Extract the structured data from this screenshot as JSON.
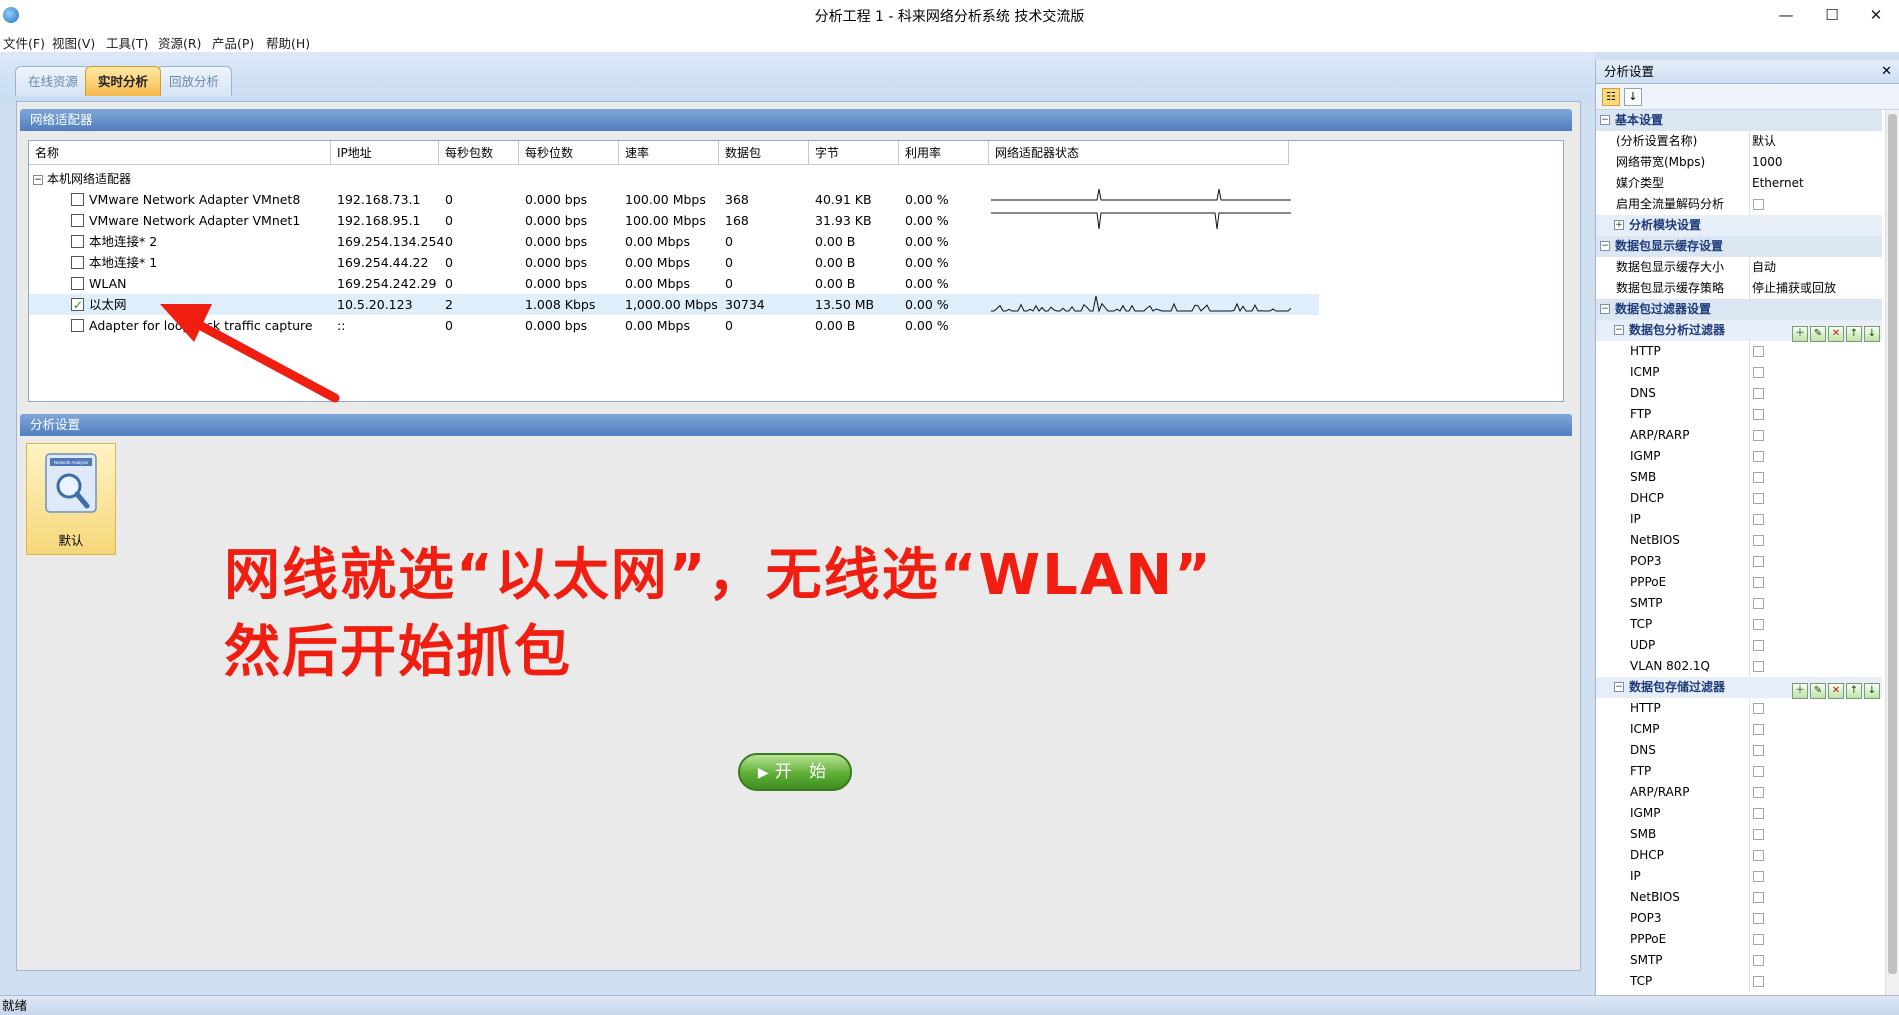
{
  "window": {
    "title": "分析工程 1 - 科来网络分析系统 技术交流版",
    "minimize": "—",
    "maximize": "☐",
    "close": "✕"
  },
  "menu": [
    "文件(F)",
    "视图(V)",
    "工具(T)",
    "资源(R)",
    "产品(P)",
    "帮助(H)"
  ],
  "tabs": [
    {
      "label": "在线资源",
      "active": false
    },
    {
      "label": "实时分析",
      "active": true
    },
    {
      "label": "回放分析",
      "active": false
    }
  ],
  "adapters_panel": {
    "title": "网络适配器",
    "columns": [
      "名称",
      "IP地址",
      "每秒包数",
      "每秒位数",
      "速率",
      "数据包",
      "字节",
      "利用率",
      "网络适配器状态"
    ],
    "group": "本机网络适配器",
    "rows": [
      {
        "name": "VMware Network Adapter VMnet8",
        "ip": "192.168.73.1",
        "pps": "0",
        "bps": "0.000 bps",
        "rate": "100.00 Mbps",
        "packets": "368",
        "bytes": "40.91 KB",
        "util": "0.00 %",
        "checked": false,
        "graph": "spikes-a"
      },
      {
        "name": "VMware Network Adapter VMnet1",
        "ip": "192.168.95.1",
        "pps": "0",
        "bps": "0.000 bps",
        "rate": "100.00 Mbps",
        "packets": "168",
        "bytes": "31.93 KB",
        "util": "0.00 %",
        "checked": false,
        "graph": "spikes-b"
      },
      {
        "name": "本地连接* 2",
        "ip": "169.254.134.254",
        "pps": "0",
        "bps": "0.000 bps",
        "rate": "0.00 Mbps",
        "packets": "0",
        "bytes": "0.00 B",
        "util": "0.00 %",
        "checked": false,
        "graph": "none"
      },
      {
        "name": "本地连接* 1",
        "ip": "169.254.44.22",
        "pps": "0",
        "bps": "0.000 bps",
        "rate": "0.00 Mbps",
        "packets": "0",
        "bytes": "0.00 B",
        "util": "0.00 %",
        "checked": false,
        "graph": "none"
      },
      {
        "name": "WLAN",
        "ip": "169.254.242.29",
        "pps": "0",
        "bps": "0.000 bps",
        "rate": "0.00 Mbps",
        "packets": "0",
        "bytes": "0.00 B",
        "util": "0.00 %",
        "checked": false,
        "graph": "none"
      },
      {
        "name": "以太网",
        "ip": "10.5.20.123",
        "pps": "2",
        "bps": "1.008 Kbps",
        "rate": "1,000.00 Mbps",
        "packets": "30734",
        "bytes": "13.50 MB",
        "util": "0.00 %",
        "checked": true,
        "graph": "busy"
      },
      {
        "name": "Adapter for loopback traffic capture",
        "ip": "::",
        "pps": "0",
        "bps": "0.000 bps",
        "rate": "0.00 Mbps",
        "packets": "0",
        "bytes": "0.00 B",
        "util": "0.00 %",
        "checked": false,
        "graph": "none"
      }
    ]
  },
  "analysis_panel": {
    "title": "分析设置",
    "profile_label": "默认",
    "profile_icon_caption": "Network Analysis",
    "start_label": "开 始"
  },
  "annotation": {
    "line1": "网线就选“以太网”，无线选“WLAN”",
    "line2": "然后开始抓包",
    "color": "#f01e10"
  },
  "side_panel": {
    "title": "分析设置",
    "close": "✕",
    "basic_title": "基本设置",
    "basic": [
      {
        "name": "(分析设置名称)",
        "value": "默认"
      },
      {
        "name": "网络带宽(Mbps)",
        "value": "1000"
      },
      {
        "name": "媒介类型",
        "value": "Ethernet"
      },
      {
        "name": "启用全流量解码分析",
        "value": ""
      }
    ],
    "module_title": "分析模块设置",
    "cache_title": "数据包显示缓存设置",
    "cache": [
      {
        "name": "数据包显示缓存大小",
        "value": "自动"
      },
      {
        "name": "数据包显示缓存策略",
        "value": "停止捕获或回放"
      }
    ],
    "filter_title": "数据包过滤器设置",
    "analysis_filter_title": "数据包分析过滤器",
    "storage_filter_title": "数据包存储过滤器",
    "analysis_filters": [
      "HTTP",
      "ICMP",
      "DNS",
      "FTP",
      "ARP/RARP",
      "IGMP",
      "SMB",
      "DHCP",
      "IP",
      "NetBIOS",
      "POP3",
      "PPPoE",
      "SMTP",
      "TCP",
      "UDP",
      "VLAN 802.1Q"
    ],
    "storage_filters": [
      "HTTP",
      "ICMP",
      "DNS",
      "FTP",
      "ARP/RARP",
      "IGMP",
      "SMB",
      "DHCP",
      "IP",
      "NetBIOS",
      "POP3",
      "PPPoE",
      "SMTP",
      "TCP"
    ]
  },
  "status": "就绪"
}
